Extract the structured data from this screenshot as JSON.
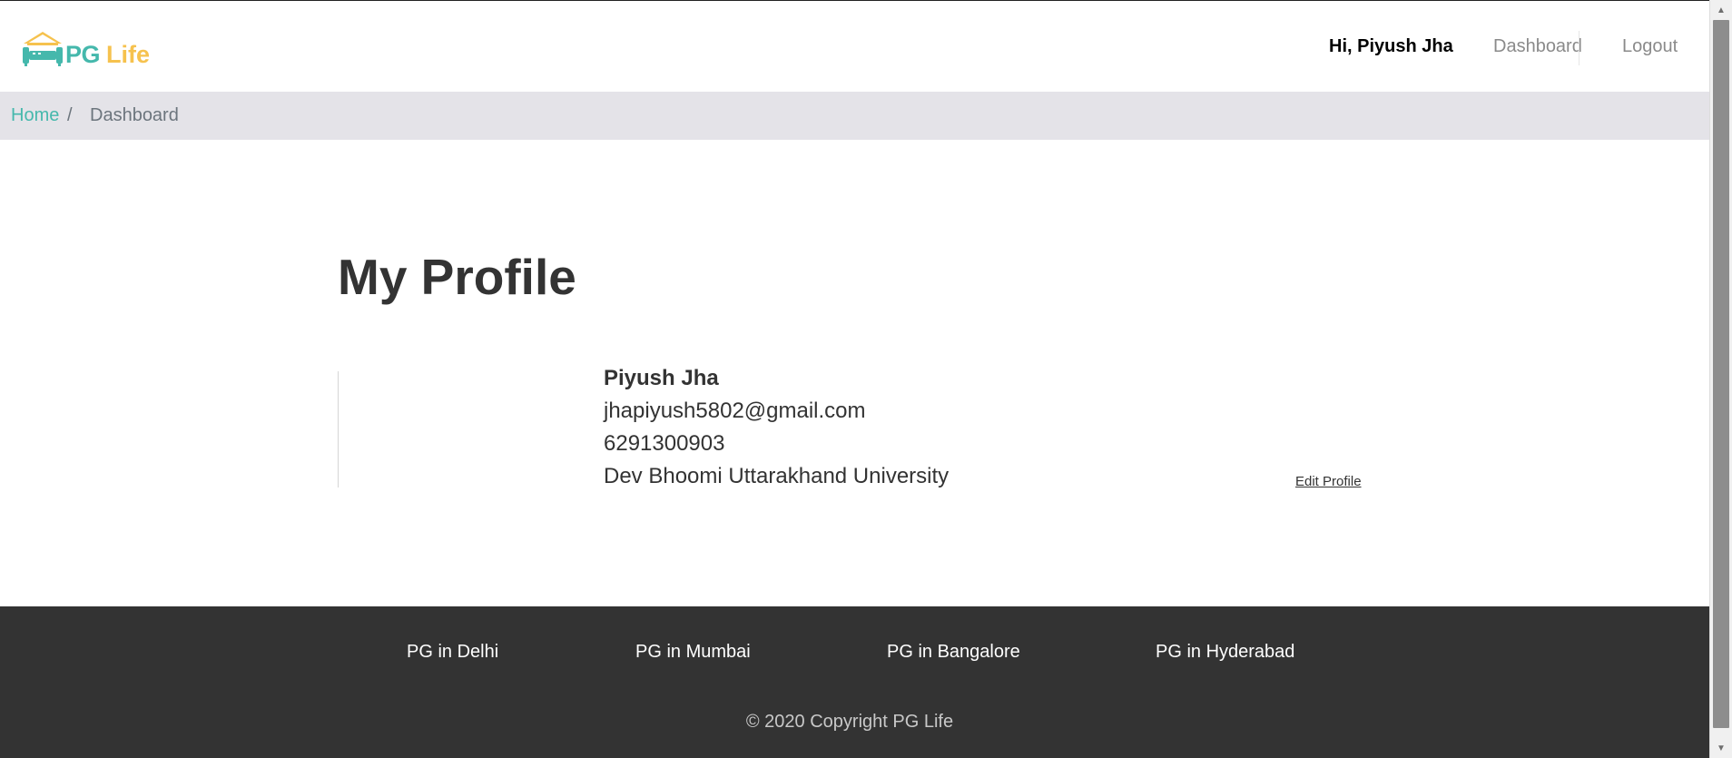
{
  "header": {
    "logo_pg": "PG",
    "logo_life": "Life",
    "greeting": "Hi, Piyush Jha",
    "dashboard_link": "Dashboard",
    "logout_link": "Logout"
  },
  "breadcrumb": {
    "home": "Home",
    "separator": "/",
    "current": "Dashboard"
  },
  "profile": {
    "title": "My Profile",
    "name": "Piyush Jha",
    "email": "jhapiyush5802@gmail.com",
    "phone": "6291300903",
    "college": "Dev Bhoomi Uttarakhand University",
    "edit_link": "Edit Profile"
  },
  "footer": {
    "links": [
      {
        "label": "PG in Delhi"
      },
      {
        "label": "PG in Mumbai"
      },
      {
        "label": "PG in Bangalore"
      },
      {
        "label": "PG in Hyderabad"
      }
    ],
    "copyright": "© 2020 Copyright PG Life"
  },
  "colors": {
    "brand_teal": "#45b8ac",
    "brand_yellow": "#f6c24e",
    "breadcrumb_bg": "#e4e3e8",
    "footer_bg": "#333333"
  },
  "icons": {
    "logo": "house-bed-icon",
    "scroll_up": "scroll-up-arrow-icon",
    "scroll_down": "scroll-down-arrow-icon"
  }
}
